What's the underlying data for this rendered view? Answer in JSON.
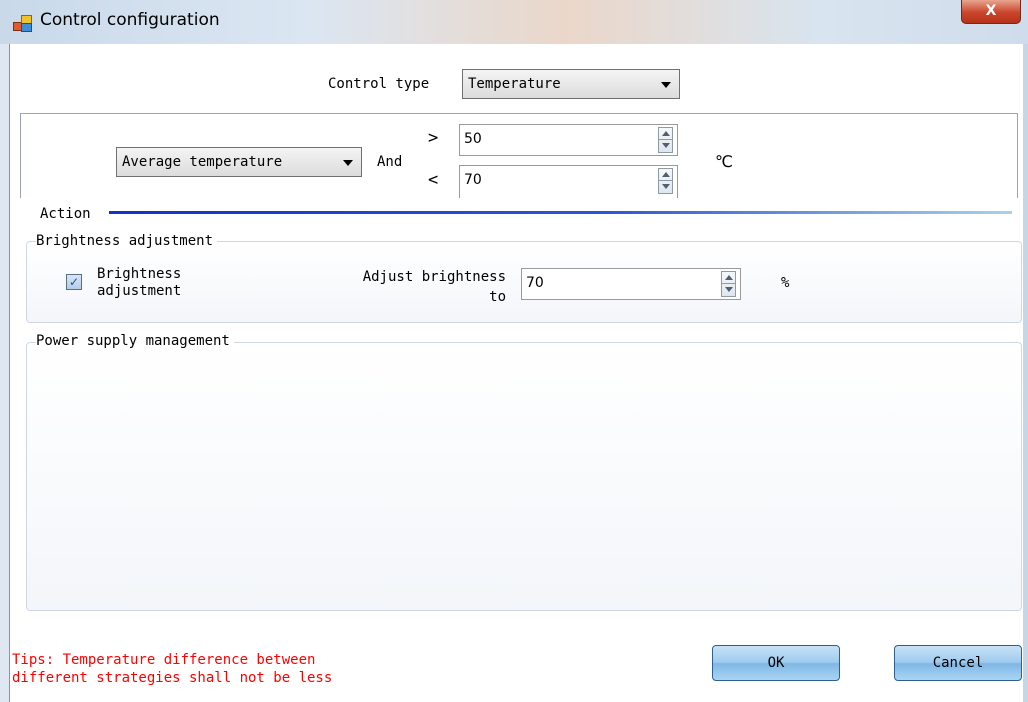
{
  "window": {
    "title": "Control configuration",
    "close_label": "X"
  },
  "control_type": {
    "label": "Control type",
    "value": "Temperature"
  },
  "condition": {
    "metric": "Average temperature",
    "joiner": "And",
    "gt_symbol": ">",
    "lt_symbol": "<",
    "gt_value": "50",
    "lt_value": "70",
    "unit": "℃"
  },
  "action": {
    "label": "Action",
    "brightness_group": {
      "title": "Brightness adjustment",
      "checkbox_checked": true,
      "checkbox_label_line1": "Brightness",
      "checkbox_label_line2": "adjustment",
      "adjust_label_line1": "Adjust brightness",
      "adjust_label_line2": "to",
      "value": "70",
      "unit": "%"
    },
    "power_group": {
      "title": "Power supply management"
    }
  },
  "tips": {
    "line1": "Tips: Temperature difference between",
    "line2": "different strategies shall not be less"
  },
  "buttons": {
    "ok": "OK",
    "cancel": "Cancel"
  }
}
